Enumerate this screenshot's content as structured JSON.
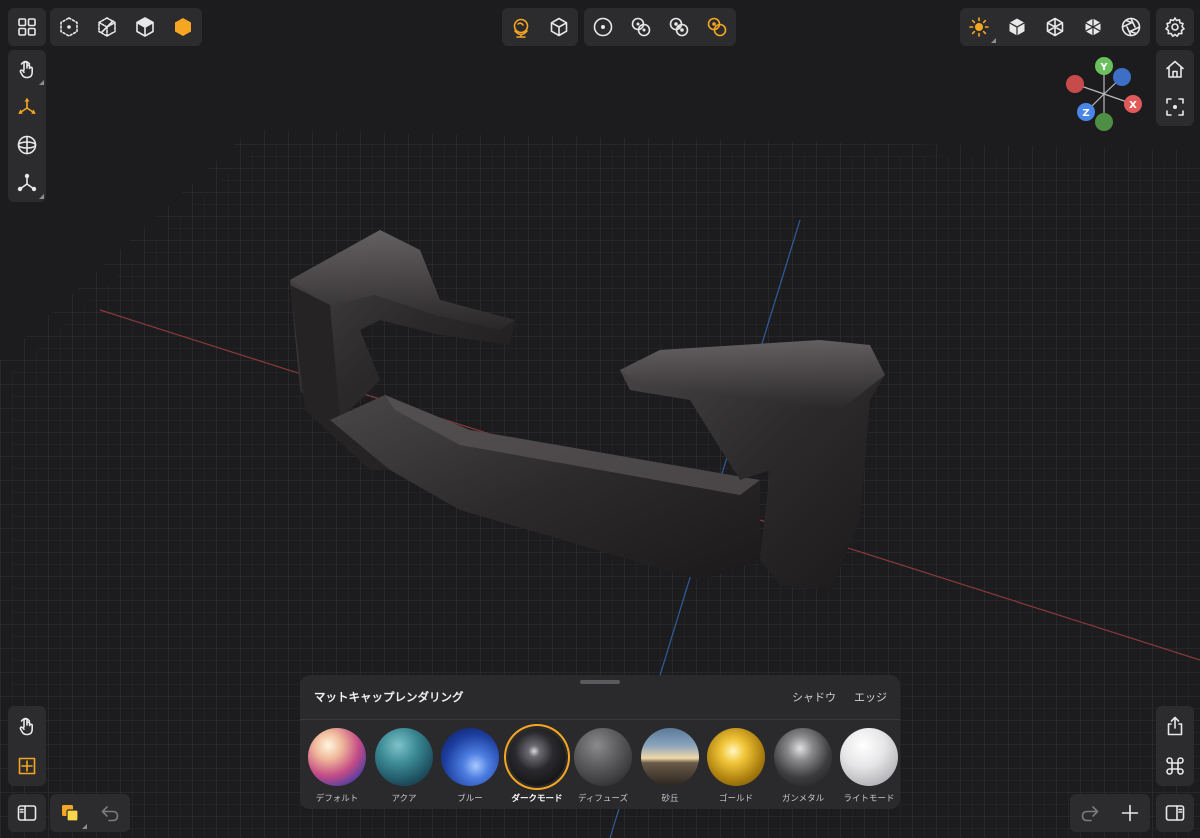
{
  "viewport": {
    "object_color": "#2e2c2d",
    "grid_color": "#3a3a3c"
  },
  "toolbar_top_left": {
    "items": [
      "grid-menu-icon",
      "vertex-view-icon",
      "wireframe-view-icon",
      "solid-view-icon",
      "shaded-view-icon"
    ]
  },
  "toolbar_top_center": {
    "items": [
      "environment-icon",
      "cube-outline-icon",
      "single-selection-icon",
      "multi-selection-icon",
      "linked-selection-icon",
      "pivot-selection-icon"
    ]
  },
  "toolbar_top_right": {
    "items": [
      "sun-light-icon",
      "solid-cube-icon",
      "wire-cube-icon",
      "box-cube-icon",
      "aperture-icon",
      "settings-gear-icon"
    ]
  },
  "toolbar_left": {
    "items": [
      "touch-gesture-icon",
      "move-axis-icon",
      "sphere-projection-icon",
      "pivot-points-icon"
    ]
  },
  "toolbar_right": {
    "items": [
      "home-icon",
      "focus-frame-icon"
    ]
  },
  "gizmo": {
    "labels": {
      "y": "Y",
      "x": "X",
      "z": "Z"
    },
    "colors": {
      "x": "#e05a5a",
      "y": "#6bbf5e",
      "z": "#4a86e8",
      "neg_x": "#c84b4b",
      "neg_y": "#4f8f45",
      "neg_z": "#3d6fc6"
    }
  },
  "bottom_left": {
    "items": [
      "touch-gesture-icon",
      "snap-grid-icon",
      "sidebar-toggle-icon",
      "color-swatch-icon",
      "undo-icon"
    ]
  },
  "bottom_right": {
    "items": [
      "share-icon",
      "command-icon",
      "redo-icon",
      "add-icon",
      "panel-toggle-icon"
    ]
  },
  "matcap_panel": {
    "title": "マットキャップレンダリング",
    "options": [
      "シャドウ",
      "エッジ"
    ],
    "selected": "ダークモード",
    "accent": "#f5a623",
    "matcaps": [
      {
        "label": "デフォルト"
      },
      {
        "label": "アクア"
      },
      {
        "label": "ブルー"
      },
      {
        "label": "ダークモード"
      },
      {
        "label": "ディフューズ"
      },
      {
        "label": "砂丘"
      },
      {
        "label": "ゴールド"
      },
      {
        "label": "ガンメタル"
      },
      {
        "label": "ライトモード"
      }
    ]
  }
}
